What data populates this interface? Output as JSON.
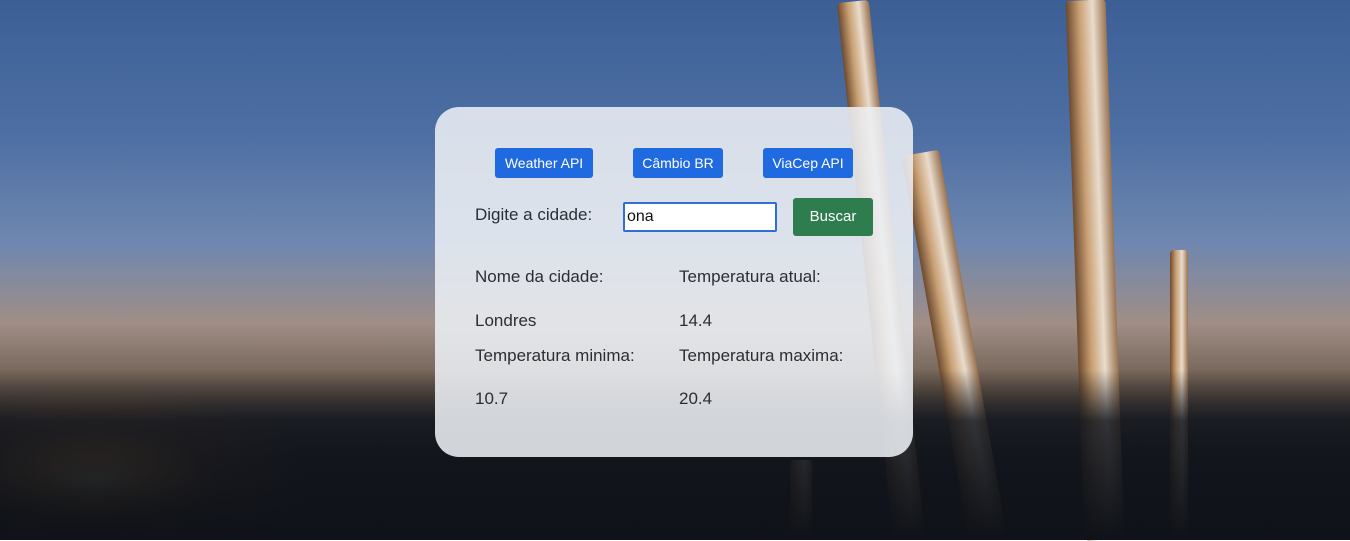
{
  "nav": {
    "weather_label": "Weather API",
    "cambio_label": "Câmbio BR",
    "viacep_label": "ViaCep API"
  },
  "search": {
    "label": "Digite a cidade:",
    "value": "ona",
    "button_label": "Buscar"
  },
  "results": {
    "city_name_label": "Nome da cidade:",
    "city_name_value": "Londres",
    "current_temp_label": "Temperatura atual:",
    "current_temp_value": "14.4",
    "min_temp_label": "Temperatura minima:",
    "min_temp_value": "10.7",
    "max_temp_label": "Temperatura maxima:",
    "max_temp_value": "20.4"
  },
  "colors": {
    "api_button": "#1f6ae0",
    "search_button": "#2e7d4f",
    "input_border": "#2f6fd1"
  }
}
